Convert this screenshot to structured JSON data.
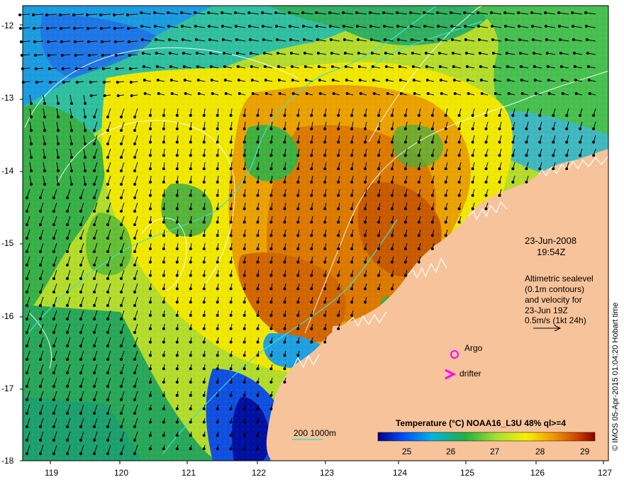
{
  "map": {
    "lat_ticks": [
      "-12",
      "-13",
      "-14",
      "-15",
      "-16",
      "-17",
      "-18"
    ],
    "lon_ticks": [
      "119",
      "120",
      "121",
      "122",
      "123",
      "124",
      "125",
      "126",
      "127"
    ],
    "lon_range": [
      118.6,
      127.0
    ],
    "lat_range": [
      -18.0,
      -11.8
    ]
  },
  "annotations": {
    "date": "23-Jun-2008",
    "time": "19:54Z",
    "altimetry_line1": "Altimetric sealevel",
    "altimetry_line2": "(0.1m contours)",
    "altimetry_line3": "and velocity for",
    "altimetry_line4": "23-Jun 19Z",
    "scale_text": "0.5m/s (1kt 24h)",
    "argo_label": "Argo",
    "drifter_label": "drifter",
    "bathy_label": "200  1000m",
    "credit": "© IMOS 05-Apr-2015 01:04:20 Hobart time"
  },
  "colorbar": {
    "title": "Temperature (°C) NOAA16_L3U 48% ql>=4",
    "ticks": [
      "25",
      "26",
      "27",
      "28",
      "29"
    ],
    "range": [
      24.2,
      29.2
    ]
  },
  "colors": {
    "land": "#f7c39a",
    "bathy_contour": "#40e0d0",
    "sealevel_contour": "#ffffff",
    "marker": "#ff00ff"
  }
}
